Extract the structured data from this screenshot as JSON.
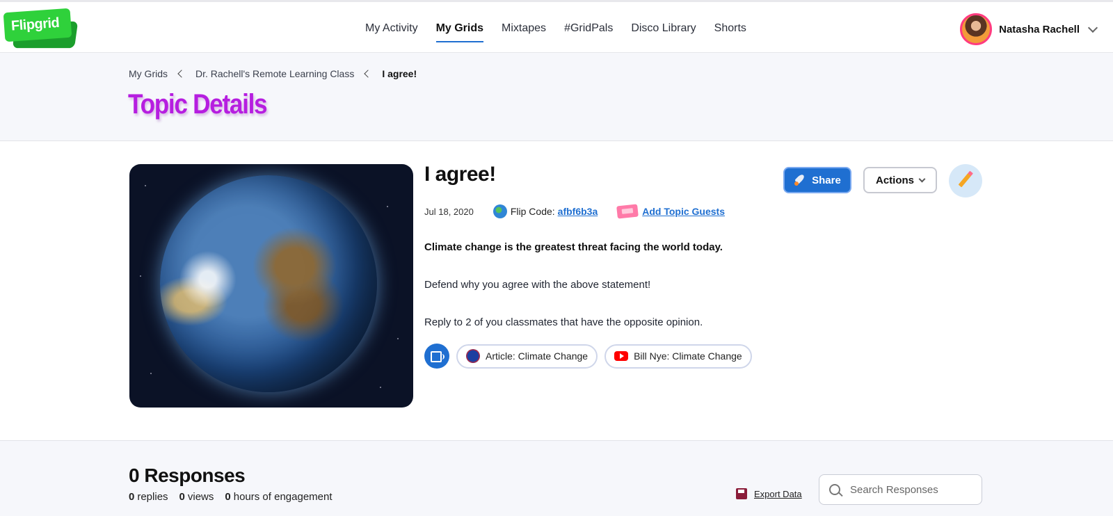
{
  "brand": {
    "logo_text": "Flipgrid"
  },
  "nav": {
    "items": [
      {
        "label": "My Activity",
        "active": false
      },
      {
        "label": "My Grids",
        "active": true
      },
      {
        "label": "Mixtapes",
        "active": false
      },
      {
        "label": "#GridPals",
        "active": false
      },
      {
        "label": "Disco Library",
        "active": false
      },
      {
        "label": "Shorts",
        "active": false
      }
    ]
  },
  "user": {
    "name": "Natasha Rachell"
  },
  "breadcrumb": {
    "items": [
      "My Grids",
      "Dr. Rachell's Remote Learning Class",
      "I agree!"
    ]
  },
  "page": {
    "title": "Topic Details"
  },
  "topic": {
    "title": "I agree!",
    "date": "Jul 18, 2020",
    "flip_code_label": "Flip Code:",
    "flip_code": "afbf6b3a",
    "add_guests_label": "Add Topic Guests",
    "statement": "Climate change is the greatest threat facing the world today.",
    "prompt": "Defend why you agree with the above statement!",
    "instruction": "Reply to 2 of you classmates that have the opposite opinion.",
    "resources": [
      {
        "label": "Article: Climate Change",
        "icon": "nasa-icon"
      },
      {
        "label": "Bill Nye: Climate Change",
        "icon": "youtube-icon"
      }
    ]
  },
  "toolbar": {
    "share_label": "Share",
    "actions_label": "Actions"
  },
  "responses": {
    "title": "0 Responses",
    "replies_count": "0",
    "replies_label": "replies",
    "views_count": "0",
    "views_label": "views",
    "hours_count": "0",
    "hours_label": "hours of engagement",
    "export_label": "Export Data",
    "search_placeholder": "Search Responses"
  },
  "colors": {
    "accent": "#1f6fd1",
    "title_purple": "#b61ee0",
    "brand_green": "#2fd13b"
  }
}
